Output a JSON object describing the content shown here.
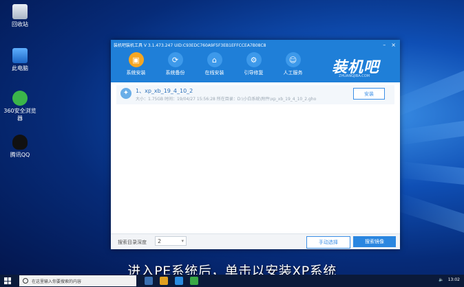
{
  "desktop": {
    "icons": [
      {
        "label": "回收站"
      },
      {
        "label": "此电脑"
      },
      {
        "label": "360安全浏览器"
      },
      {
        "label": "腾讯QQ"
      }
    ]
  },
  "window": {
    "title": "装机吧装机工具 V 3.1.473.247 UID:C93EDC760A9F5F3EB1EFFCCEA7B08C8",
    "controls": [
      "–",
      "×"
    ],
    "brand": "装机吧",
    "brand_sub": "ZHUANGJIBA.COM",
    "toolbar": [
      {
        "label": "系统安装",
        "icon": "system-install-icon"
      },
      {
        "label": "系统备份",
        "icon": "system-backup-icon"
      },
      {
        "label": "在线安装",
        "icon": "online-install-icon"
      },
      {
        "label": "引导修复",
        "icon": "boot-repair-icon"
      },
      {
        "label": "人工服务",
        "icon": "support-icon"
      }
    ],
    "list": [
      {
        "title": "1、xp_xb_19_4_10_2",
        "meta": "大小：1.75GB   时间：19/04/27 15:56:28  所在目录：D:\\小白系统\\附件\\xp_xb_19_4_10_2.gho",
        "action": "安装"
      }
    ],
    "bottom": {
      "depth_label": "搜索目录深度",
      "depth_value": "2",
      "manual_btn": "手动选择",
      "search_btn": "搜索镜像"
    }
  },
  "subtitle": "进入PE系统后，单击以安装XP系统",
  "taskbar": {
    "search_placeholder": "在这里输入你要搜索的内容",
    "time": "13:02"
  }
}
